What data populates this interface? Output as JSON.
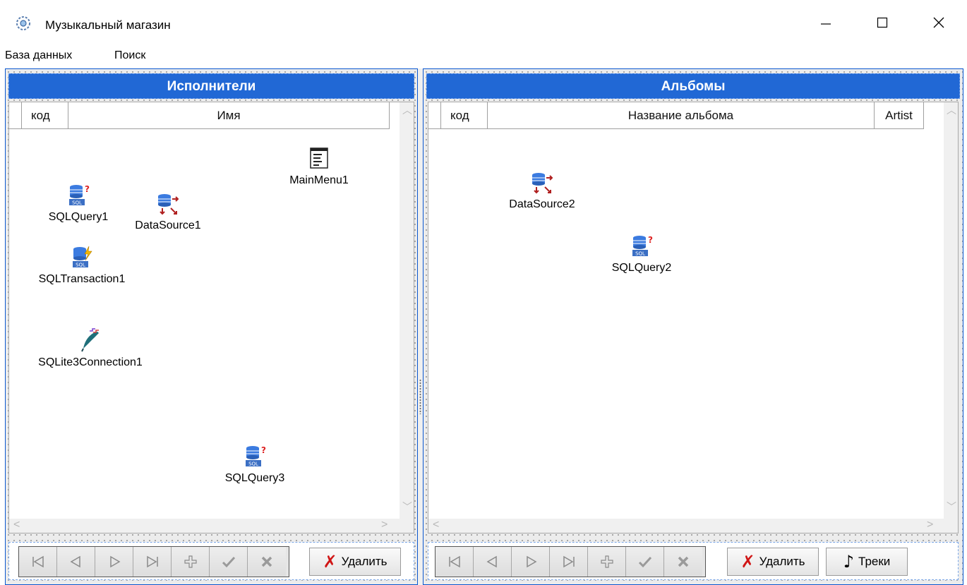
{
  "window": {
    "title": "Музыкальный магазин",
    "icon": "gear-app-icon",
    "controls": {
      "minimize": "—",
      "maximize": "☐",
      "close": "✕"
    }
  },
  "menu": {
    "items": [
      "База данных",
      "Поиск"
    ]
  },
  "left_panel": {
    "header": "Исполнители",
    "columns": [
      "код",
      "Имя"
    ],
    "components": [
      {
        "label": "MainMenu1",
        "icon": "main-menu-icon"
      },
      {
        "label": "SQLQuery1",
        "icon": "sql-query-icon"
      },
      {
        "label": "DataSource1",
        "icon": "data-source-icon"
      },
      {
        "label": "SQLTransaction1",
        "icon": "sql-transaction-icon"
      },
      {
        "label": "SQLite3Connection1",
        "icon": "sqlite-connection-icon"
      },
      {
        "label": "SQLQuery3",
        "icon": "sql-query-icon"
      }
    ],
    "delete_label": "Удалить"
  },
  "right_panel": {
    "header": "Альбомы",
    "columns": [
      "код",
      "Название альбома",
      "Artist"
    ],
    "components": [
      {
        "label": "DataSource2",
        "icon": "data-source-icon"
      },
      {
        "label": "SQLQuery2",
        "icon": "sql-query-icon"
      }
    ],
    "delete_label": "Удалить",
    "tracks_label": "Треки"
  },
  "navigator": {
    "buttons": [
      "first-icon",
      "prior-icon",
      "next-icon",
      "last-icon",
      "insert-icon",
      "post-icon",
      "cancel-icon"
    ]
  },
  "colors": {
    "header_blue": "#2168d5",
    "panel_border": "#0a57d0",
    "delete_red": "#d01515"
  }
}
